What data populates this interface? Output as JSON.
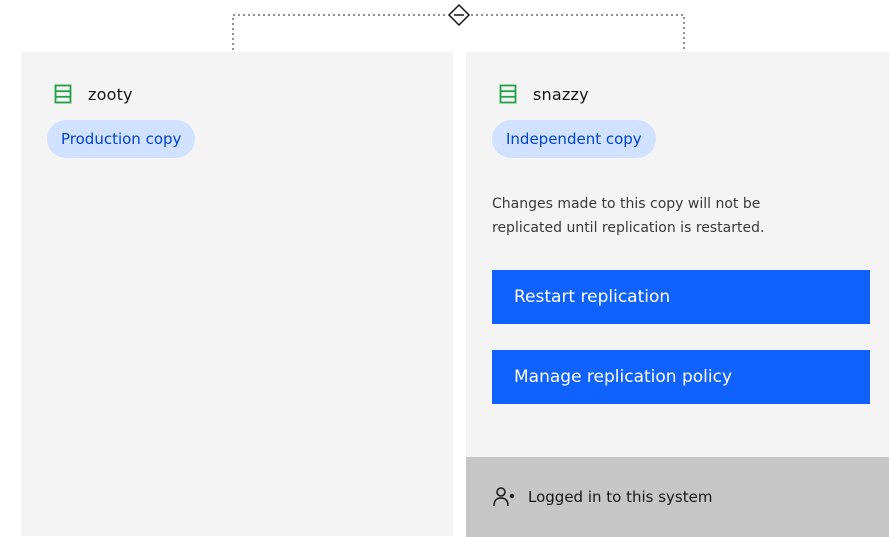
{
  "colors": {
    "panel_bg": "#f4f4f4",
    "tag_bg": "#d0e2ff",
    "tag_text": "#0043ce",
    "button_bg": "#0f62fe",
    "footer_bg": "#c6c6c6",
    "storage_icon": "#24a148"
  },
  "connector": {
    "icon": "diamond-link-icon"
  },
  "left_system": {
    "icon": "storage-system-icon",
    "name": "zooty",
    "tag": "Production copy"
  },
  "right_system": {
    "icon": "storage-system-icon",
    "name": "snazzy",
    "tag": "Independent copy",
    "description_line1": "Changes made to this copy will not be",
    "description_line2": "replicated until replication is restarted.",
    "restart_button": "Restart replication",
    "manage_button": "Manage replication policy",
    "footer_icon": "user-online-icon",
    "footer_text": "Logged in to this system"
  }
}
